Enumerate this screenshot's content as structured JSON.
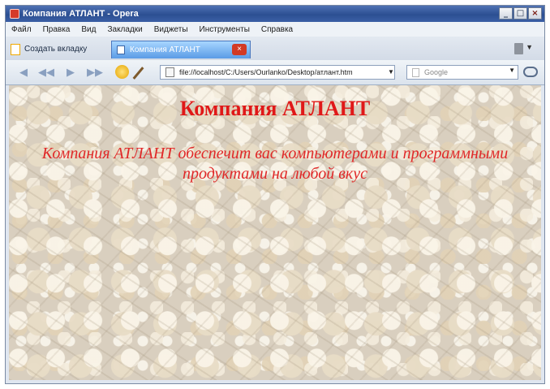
{
  "window": {
    "title": "Компания АТЛАНТ - Opera",
    "minimize_glyph": "_",
    "maximize_glyph": "□",
    "close_glyph": "×"
  },
  "menu": {
    "items": [
      "Файл",
      "Правка",
      "Вид",
      "Закладки",
      "Виджеты",
      "Инструменты",
      "Справка"
    ]
  },
  "tabs": {
    "new_tab_label": "Создать вкладку",
    "active_tab_label": "Компания АТЛАНТ",
    "close_glyph": "×"
  },
  "toolbar": {
    "back_glyph": "◀",
    "forward_glyph": "▶",
    "fast_forward_glyph": "▶▶",
    "rewind_glyph": "◀◀",
    "address": "file://localhost/C:/Users/Ourlanko/Desktop/атлант.htm",
    "dropdown_glyph": "▼",
    "search_placeholder": "Google"
  },
  "page": {
    "heading": "Компания АТЛАНТ",
    "subtitle": "Компания АТЛАНТ обеспечит вас компьютерами и программными продуктами на любой вкус"
  }
}
